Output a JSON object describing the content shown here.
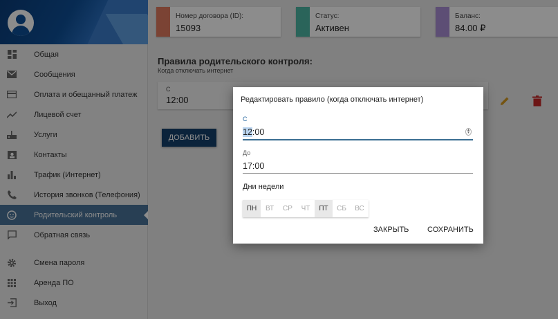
{
  "sidebar": {
    "menu": [
      {
        "label": "Общая",
        "icon": "dashboard-icon"
      },
      {
        "label": "Сообщения",
        "icon": "mail-icon"
      },
      {
        "label": "Оплата и обещанный платеж",
        "icon": "credit-card-icon"
      },
      {
        "label": "Лицевой счет",
        "icon": "trending-icon"
      },
      {
        "label": "Услуги",
        "icon": "router-icon"
      },
      {
        "label": "Контакты",
        "icon": "contacts-icon"
      },
      {
        "label": "Трафик (Интернет)",
        "icon": "bar-chart-icon"
      },
      {
        "label": "История звонков (Телефония)",
        "icon": "phone-icon"
      },
      {
        "label": "Родительский контроль",
        "icon": "child-face-icon"
      },
      {
        "label": "Обратная связь",
        "icon": "feedback-icon"
      }
    ],
    "menu_secondary": [
      {
        "label": "Смена пароля",
        "icon": "gear-icon"
      },
      {
        "label": "Аренда ПО",
        "icon": "apps-grid-icon"
      },
      {
        "label": "Выход",
        "icon": "exit-icon"
      }
    ],
    "active_index": 8
  },
  "cards": {
    "contract": {
      "label": "Номер договора (ID):",
      "value": "15093",
      "color": "#e07a5f"
    },
    "status": {
      "label": "Статус:",
      "value": "Активен",
      "color": "#4db6a4"
    },
    "balance": {
      "label": "Баланс:",
      "value": "84.00 ₽",
      "color": "#a98ed6"
    }
  },
  "main": {
    "title": "Правила родительского контроля:",
    "subtitle": "Когда отключать интернет",
    "rule": {
      "from_label": "С",
      "from_value": "12:00"
    },
    "add_label": "ДОБАВИТЬ"
  },
  "dialog": {
    "title": "Редактировать правило (когда отключать интернет)",
    "from_label": "С",
    "from_hours": "12",
    "from_rest": ":00",
    "to_label": "До",
    "to_value": "17:00",
    "days_label": "Дни недели",
    "days": [
      {
        "label": "ПН",
        "on": true
      },
      {
        "label": "ВТ",
        "on": false
      },
      {
        "label": "СР",
        "on": false
      },
      {
        "label": "ЧТ",
        "on": false
      },
      {
        "label": "ПТ",
        "on": true
      },
      {
        "label": "СБ",
        "on": false
      },
      {
        "label": "ВС",
        "on": false
      }
    ],
    "close_label": "ЗАКРЫТЬ",
    "save_label": "СОХРАНИТЬ"
  }
}
